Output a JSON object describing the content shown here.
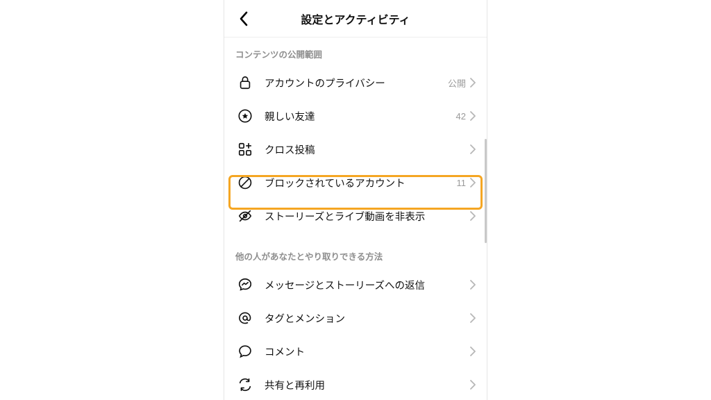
{
  "header": {
    "title": "設定とアクティビティ"
  },
  "sections": {
    "s1": {
      "header": "コンテンツの公開範囲"
    },
    "s2": {
      "header": "他の人があなたとやり取りできる方法"
    }
  },
  "rows": {
    "privacy": {
      "label": "アカウントのプライバシー",
      "value": "公開"
    },
    "closeFriends": {
      "label": "親しい友達",
      "value": "42"
    },
    "crossPost": {
      "label": "クロス投稿",
      "value": ""
    },
    "blocked": {
      "label": "ブロックされているアカウント",
      "value": "11"
    },
    "hideStory": {
      "label": "ストーリーズとライブ動画を非表示",
      "value": ""
    },
    "messages": {
      "label": "メッセージとストーリーズへの返信",
      "value": ""
    },
    "tags": {
      "label": "タグとメンション",
      "value": ""
    },
    "comments": {
      "label": "コメント",
      "value": ""
    },
    "share": {
      "label": "共有と再利用",
      "value": ""
    }
  }
}
